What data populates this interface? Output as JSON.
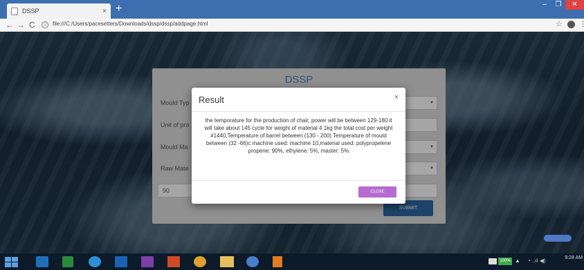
{
  "browser": {
    "tab_title": "DSSP",
    "tab_close": "×",
    "new_tab": "+",
    "window_controls": {
      "minimize": "–",
      "maximize": "❐",
      "close": "✕"
    },
    "nav": {
      "back": "←",
      "forward": "→",
      "reload": "C",
      "info": "i"
    },
    "url": "file:///C:/Users/pacesetters/Downloads/dssp/dssp/addpage.html",
    "star": "☆",
    "menu": "⋮"
  },
  "form": {
    "title": "DSSP",
    "fields": [
      {
        "label": "Mould Typ"
      },
      {
        "label": "Unit of pro"
      },
      {
        "label": "Mould Ma"
      },
      {
        "label": "Raw Mate"
      }
    ],
    "quantity_value": "90",
    "submit_label": "SUBMIT",
    "select_arrow": "▼"
  },
  "modal": {
    "title": "Result",
    "close_glyph": "×",
    "body": "the temporature for the production of chair, power will be between 129-180 it will take about 145 cycle for weight of material 4 1kg the total cost per weight #1440,Temperature of barrel between (130 - 200) Temperature of mould between (32 -66)c machine used: machine 10,material used: polypropelene propene: 90%, ethylene: 5%, master: 5%",
    "button_label": "CLOSE"
  },
  "taskbar": {
    "battery_percent": "100%",
    "clock": "9:28 AM"
  },
  "colors": {
    "tabstrip": "#3d6fb0",
    "form_title": "#4a7fb5",
    "submit": "#2f68a4",
    "close_button": "#b76ad0",
    "taskbar": "#0c1a2a"
  }
}
